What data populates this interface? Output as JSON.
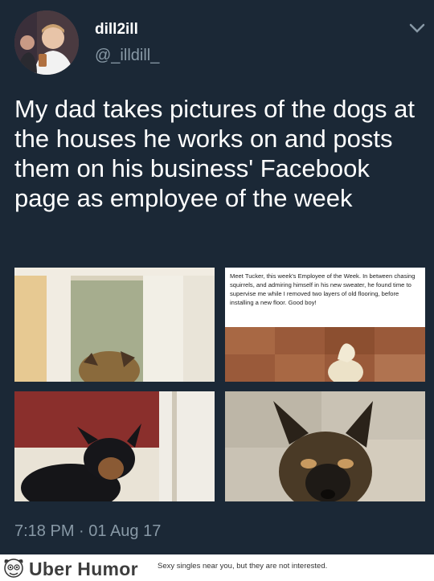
{
  "tweet": {
    "display_name": "dill2ill",
    "handle": "@_illdill_",
    "text": "My dad takes pictures of the dogs at the houses he works on and posts them on his business' Facebook page as employee of the week",
    "timestamp": "7:18 PM · 01 Aug 17"
  },
  "photos": {
    "facebook_caption": "Meet Tucker, this week's Employee of the Week. In between chasing squirrels, and admiring himself in his new sweater, he found time to supervise me while I removed two layers of old flooring, before installing a new floor. Good boy!"
  },
  "icons": {
    "menu": "chevron-down-icon",
    "watermark": "uber-humor-logo-icon"
  },
  "footer": {
    "brand": "Uber Humor",
    "ad_text": "Sexy singles near you, but they are not interested."
  },
  "colors": {
    "background": "#1b2836",
    "primary_text": "#ffffff",
    "secondary_text": "#8899a6"
  }
}
